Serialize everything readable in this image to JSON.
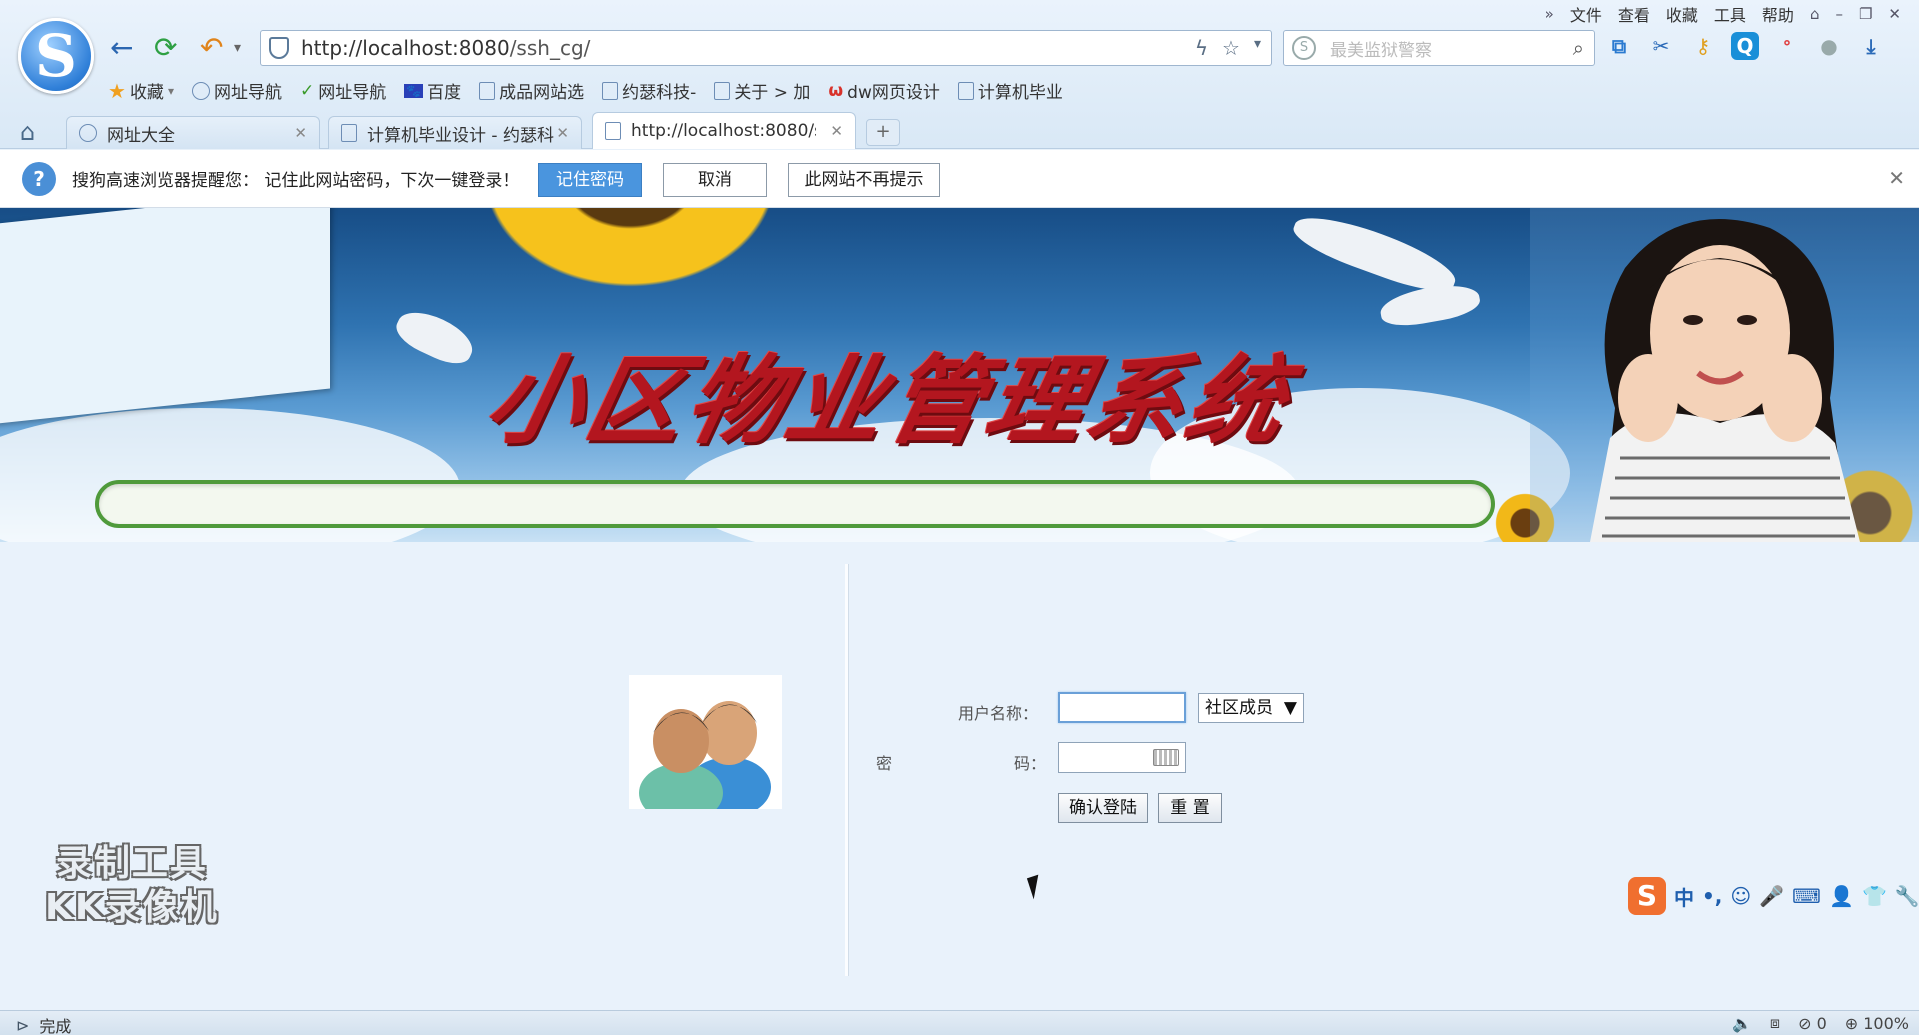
{
  "menu": {
    "items": [
      "文件",
      "查看",
      "收藏",
      "工具",
      "帮助"
    ],
    "chevrons": "»"
  },
  "address": {
    "url_host": "http://localhost:8080",
    "url_path": "/ssh_cg/"
  },
  "search": {
    "placeholder": "最美监狱警察"
  },
  "bookmarks": [
    {
      "label": "收藏",
      "icon": "star-icon"
    },
    {
      "label": "网址导航",
      "icon": "globe-icon"
    },
    {
      "label": "网址导航",
      "icon": "hao-icon"
    },
    {
      "label": "百度",
      "icon": "baidu-paw-icon"
    },
    {
      "label": "成品网站选",
      "icon": "page-icon"
    },
    {
      "label": "约瑟科技-",
      "icon": "page-icon"
    },
    {
      "label": "关于 > 加",
      "icon": "page-icon"
    },
    {
      "label": "dw网页设计",
      "icon": "dw-icon"
    },
    {
      "label": "计算机毕业",
      "icon": "page-icon"
    }
  ],
  "tabs": [
    {
      "label": "网址大全",
      "active": false
    },
    {
      "label": "计算机毕业设计 - 约瑟科",
      "active": false
    },
    {
      "label": "http://localhost:8080/s",
      "active": true
    }
  ],
  "notify": {
    "message": "搜狗高速浏览器提醒您： 记住此网站密码，下次一键登录！",
    "remember": "记住密码",
    "cancel": "取消",
    "never": "此网站不再提示"
  },
  "banner": {
    "title": "小区物业管理系统"
  },
  "login": {
    "username_label": "用户名称：",
    "password_label_left": "密",
    "password_label_right": "码：",
    "role": "社区成员",
    "confirm": "确认登陆",
    "reset": "重 置"
  },
  "watermark": {
    "line1": "录制工具",
    "line2": "KK录像机"
  },
  "ime": {
    "lang": "中"
  },
  "status": {
    "text": "完成",
    "count": "0",
    "zoom": "100%"
  },
  "colors": {
    "accent": "#4a95de",
    "banner_title": "#b3161f",
    "chrome": "#dde9f5"
  }
}
